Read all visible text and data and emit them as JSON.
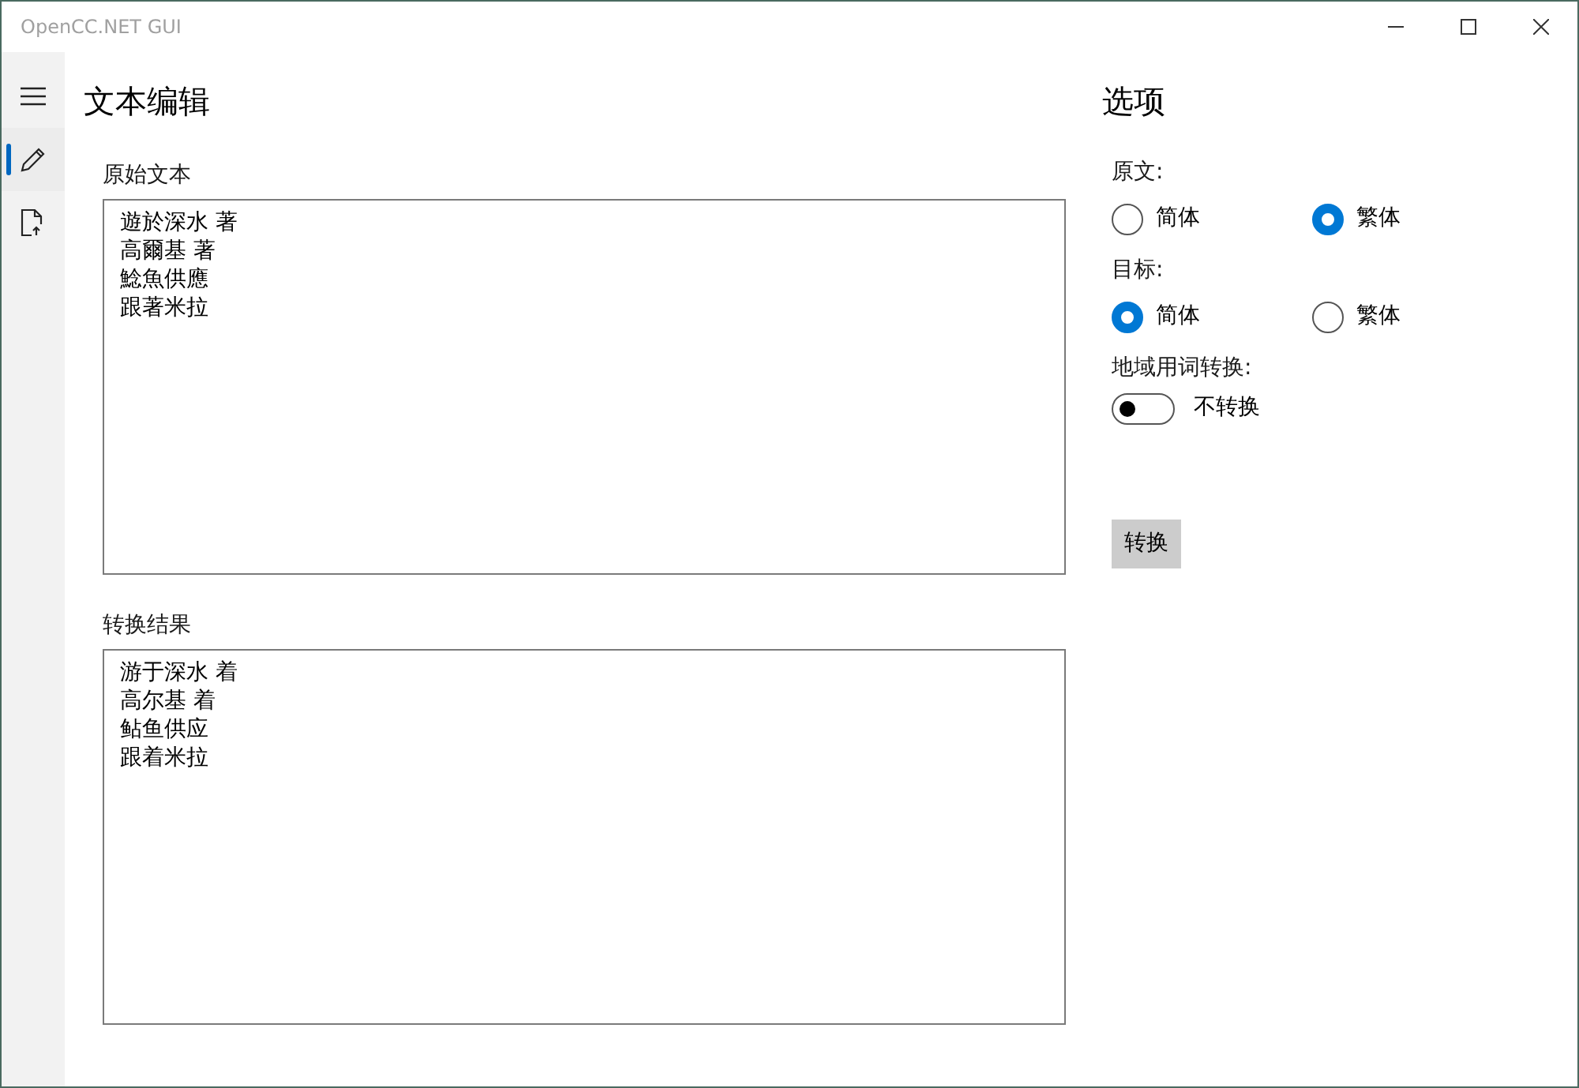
{
  "window": {
    "title": "OpenCC.NET GUI"
  },
  "nav": [
    {
      "kind": "menu",
      "selected": false
    },
    {
      "kind": "edit",
      "selected": true
    },
    {
      "kind": "file",
      "selected": false
    }
  ],
  "editor": {
    "title": "文本编辑",
    "source": {
      "label": "原始文本",
      "lines": [
        "遊於深水 著",
        "高爾基 著",
        "鯰魚供應",
        "跟著米拉"
      ]
    },
    "result": {
      "label": "转换结果",
      "lines": [
        "游于深水 着",
        "高尔基 着",
        "鲇鱼供应",
        "跟着米拉"
      ]
    }
  },
  "options": {
    "title": "选项",
    "groups": [
      {
        "label": "原文:",
        "options": [
          {
            "label": "简体",
            "selected": false
          },
          {
            "label": "繁体",
            "selected": true
          }
        ]
      },
      {
        "label": "目标:",
        "options": [
          {
            "label": "简体",
            "selected": true
          },
          {
            "label": "繁体",
            "selected": false
          }
        ]
      }
    ],
    "region_toggle": {
      "label": "地域用词转换:",
      "on": false,
      "state_text": "不转换"
    },
    "convert_button": "转换"
  }
}
